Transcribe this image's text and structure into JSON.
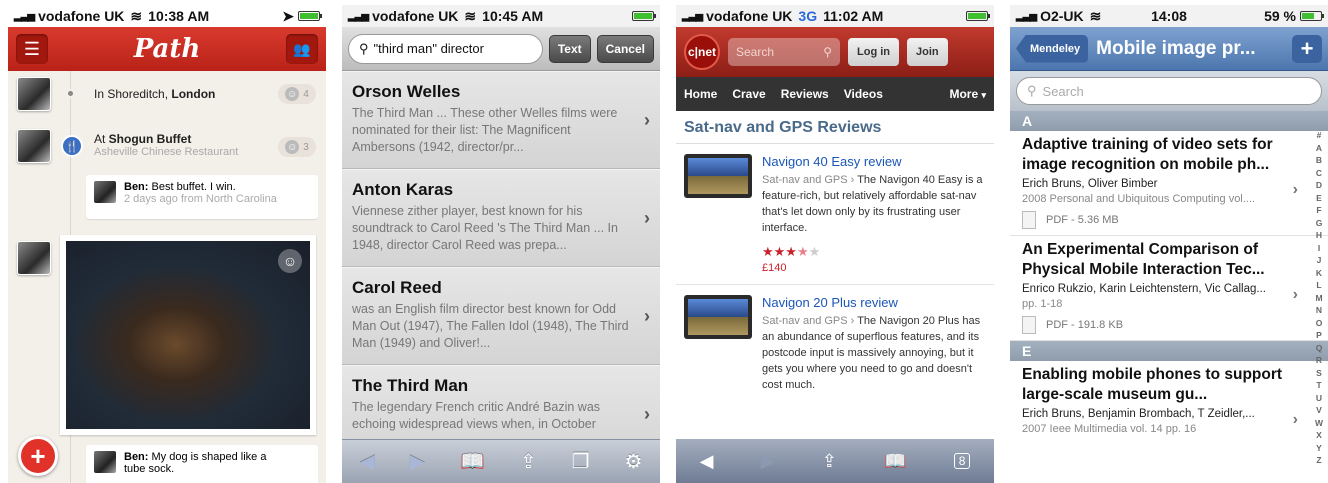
{
  "path": {
    "status": {
      "carrier": "vodafone UK",
      "time": "10:38 AM"
    },
    "logo": "Path",
    "moments": [
      {
        "text_prefix": "In Shoreditch, ",
        "text_bold": "London",
        "count": "4"
      },
      {
        "text_prefix": "At ",
        "text_bold": "Shogun Buffet",
        "sub": "Asheville Chinese Restaurant",
        "count": "3"
      }
    ],
    "comments": [
      {
        "author": "Ben:",
        "text": " Best buffet. I win.",
        "meta": "2 days ago from North Carolina"
      },
      {
        "author": "Ben:",
        "text": " My dog is shaped like a tube sock."
      }
    ]
  },
  "search": {
    "status": {
      "carrier": "vodafone UK",
      "time": "10:45 AM"
    },
    "query": "\"third man\" director",
    "text_btn": "Text",
    "cancel_btn": "Cancel",
    "results": [
      {
        "title": "Orson Welles",
        "snippet": "The Third Man  ... These other Welles films were nominated for their list: The Magnificent Ambersons (1942, director/pr..."
      },
      {
        "title": "Anton Karas",
        "snippet": "Viennese zither  player, best known for his soundtrack to Carol Reed 's The Third Man ... In 1948, director Carol Reed  was prepa..."
      },
      {
        "title": "Carol Reed",
        "snippet": "was an English  film director  best known for Odd Man Out  (1947), The Fallen Idol (1948), The Third Man  (1949) and Oliver!..."
      },
      {
        "title": "The Third Man",
        "snippet": "The legendary French critic André Bazin was echoing widespread views when, in October"
      }
    ]
  },
  "cnet": {
    "status": {
      "carrier": "vodafone UK",
      "network": "3G",
      "time": "11:02 AM"
    },
    "logo": "c|net",
    "search_placeholder": "Search",
    "login": "Log in",
    "join": "Join",
    "nav": [
      "Home",
      "Crave",
      "Reviews",
      "Videos"
    ],
    "more": "More",
    "section": "Sat-nav and GPS Reviews",
    "reviews": [
      {
        "title": "Navigon 40 Easy review",
        "cat": "Sat-nav and GPS",
        "sep": " › ",
        "text": "The Navigon 40 Easy is a feature-rich, but relatively affordable sat-nav that's let down only by its frustrating user interface.",
        "rating": 3.5,
        "price": "£140"
      },
      {
        "title": "Navigon 20 Plus review",
        "cat": "Sat-nav and GPS",
        "sep": " › ",
        "text": "The Navigon 20 Plus has an abundance of superflous features, and its postcode input is massively annoying, but it gets you where you need to go and doesn't cost much."
      }
    ],
    "tab_badge": "8"
  },
  "mendeley": {
    "status": {
      "carrier": "O2-UK",
      "time": "14:08",
      "battery": "59 %"
    },
    "back": "Mendeley",
    "title": "Mobile image pr...",
    "add": "+",
    "search_placeholder": "Search",
    "sections": [
      {
        "letter": "A",
        "docs": [
          {
            "title": "Adaptive training of video sets for image recognition on mobile ph...",
            "authors": "Erich Bruns, Oliver Bimber",
            "meta": "2008 Personal and Ubiquitous Computing vol....",
            "pdf": "PDF - 5.36 MB"
          },
          {
            "title": "An Experimental Comparison of Physical Mobile Interaction Tec...",
            "authors": "Enrico Rukzio, Karin Leichtenstern, Vic Callag...",
            "meta": "pp. 1-18",
            "pdf": "PDF - 191.8 KB"
          }
        ]
      },
      {
        "letter": "E",
        "docs": [
          {
            "title": "Enabling mobile phones to support large-scale museum gu...",
            "authors": "Erich Bruns, Benjamin Brombach, T Zeidler,...",
            "meta": "2007 Ieee Multimedia vol. 14 pp. 16"
          }
        ]
      }
    ],
    "index": [
      "#",
      "A",
      "B",
      "C",
      "D",
      "E",
      "F",
      "G",
      "H",
      "I",
      "J",
      "K",
      "L",
      "M",
      "N",
      "O",
      "P",
      "Q",
      "R",
      "S",
      "T",
      "U",
      "V",
      "W",
      "X",
      "Y",
      "Z"
    ]
  }
}
